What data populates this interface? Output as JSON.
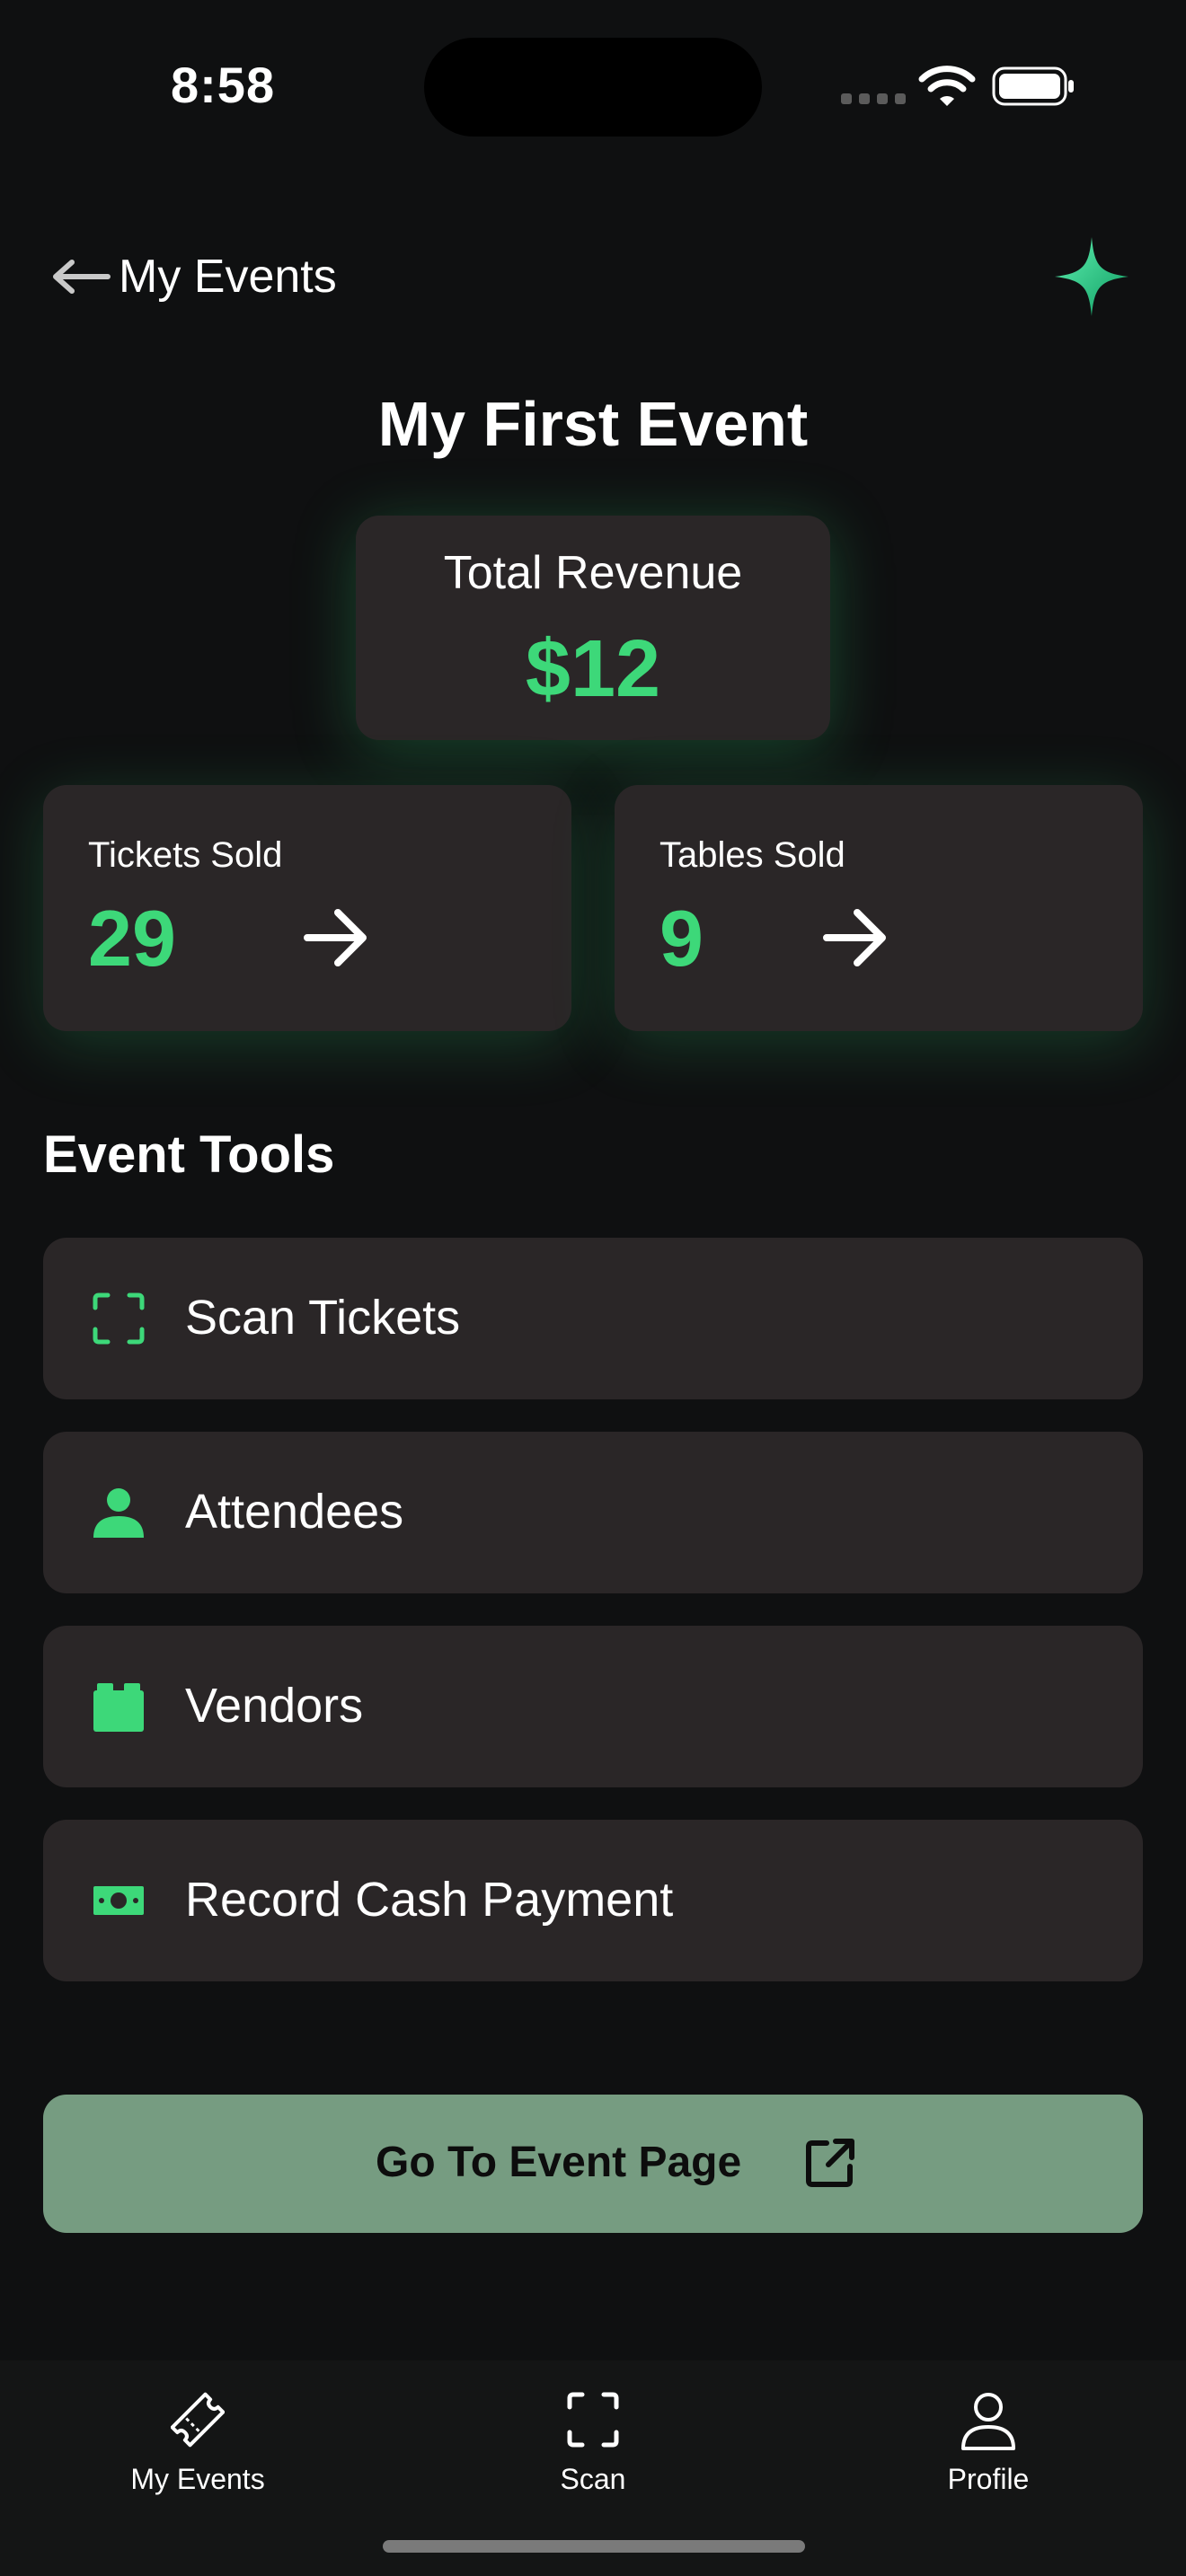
{
  "status_bar": {
    "time": "8:58"
  },
  "header": {
    "back_label": "My Events"
  },
  "page": {
    "title": "My First Event"
  },
  "revenue": {
    "label": "Total Revenue",
    "value": "$12"
  },
  "stats": {
    "tickets": {
      "label": "Tickets Sold",
      "value": "29"
    },
    "tables": {
      "label": "Tables Sold",
      "value": "9"
    }
  },
  "tools": {
    "title": "Event Tools",
    "items": [
      {
        "label": "Scan Tickets",
        "icon": "scan-frame-icon"
      },
      {
        "label": "Attendees",
        "icon": "person-icon"
      },
      {
        "label": "Vendors",
        "icon": "vendor-block-icon"
      },
      {
        "label": "Record Cash Payment",
        "icon": "cash-icon"
      }
    ]
  },
  "cta": {
    "label": "Go To Event Page",
    "icon": "external-link-icon"
  },
  "tab_bar": {
    "items": [
      {
        "label": "My Events",
        "icon": "ticket-icon"
      },
      {
        "label": "Scan",
        "icon": "scan-frame-icon"
      },
      {
        "label": "Profile",
        "icon": "user-outline-icon"
      }
    ]
  },
  "colors": {
    "accent": "#3dd879",
    "background": "#0f1011",
    "card": "#2a2627",
    "cta_background": "#769c81"
  }
}
